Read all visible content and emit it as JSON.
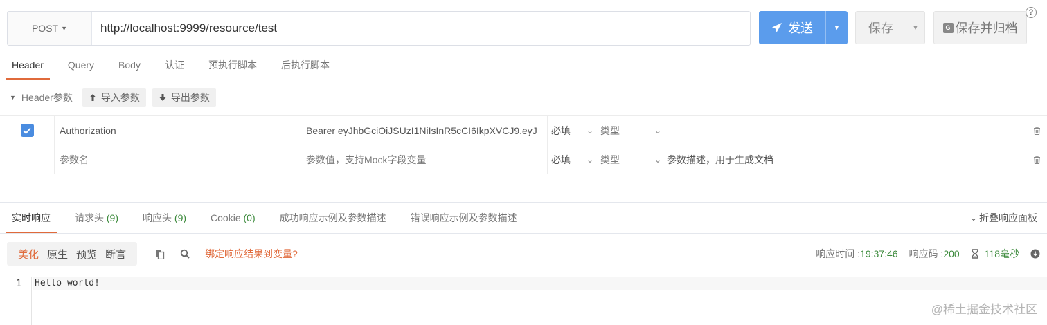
{
  "request": {
    "method": "POST",
    "url": "http://localhost:9999/resource/test",
    "send_label": "发送",
    "save_label": "保存",
    "save_archive_label": "保存并归档",
    "archive_icon_letter": "G"
  },
  "help_icon": "?",
  "request_tabs": [
    {
      "label": "Header",
      "active": true
    },
    {
      "label": "Query"
    },
    {
      "label": "Body"
    },
    {
      "label": "认证"
    },
    {
      "label": "预执行脚本"
    },
    {
      "label": "后执行脚本"
    }
  ],
  "header_params": {
    "title": "Header参数",
    "import_label": "导入参数",
    "export_label": "导出参数",
    "rows": [
      {
        "checked": true,
        "name": "Authorization",
        "value": "Bearer eyJhbGciOiJSUzI1NiIsInR5cCI6IkpXVCJ9.eyJ",
        "required": "必填",
        "type": "类型",
        "description": ""
      }
    ],
    "new_row": {
      "name_placeholder": "参数名",
      "value_placeholder": "参数值，支持Mock字段变量",
      "required": "必填",
      "type": "类型",
      "desc_placeholder": "参数描述，用于生成文档"
    }
  },
  "response_tabs": [
    {
      "label": "实时响应",
      "active": true
    },
    {
      "label": "请求头",
      "count": "(9)"
    },
    {
      "label": "响应头",
      "count": "(9)"
    },
    {
      "label": "Cookie",
      "count": "(0)"
    },
    {
      "label": "成功响应示例及参数描述"
    },
    {
      "label": "错误响应示例及参数描述"
    }
  ],
  "collapse_panel_label": "折叠响应面板",
  "view_modes": [
    {
      "label": "美化",
      "active": true
    },
    {
      "label": "原生"
    },
    {
      "label": "预览"
    },
    {
      "label": "断言"
    }
  ],
  "bind_variable_link": "绑定响应结果到变量?",
  "response_meta": {
    "time_label": "响应时间 : ",
    "time_value": "19:37:46",
    "code_label": "响应码 : ",
    "code_value": "200",
    "duration": "118毫秒"
  },
  "code": {
    "line_number": "1",
    "content": "Hello world!"
  },
  "watermark": "@稀土掘金技术社区",
  "colors": {
    "accent_orange": "#e06a3b",
    "primary_blue": "#5b9cec",
    "success_green": "#3c8a3c"
  }
}
